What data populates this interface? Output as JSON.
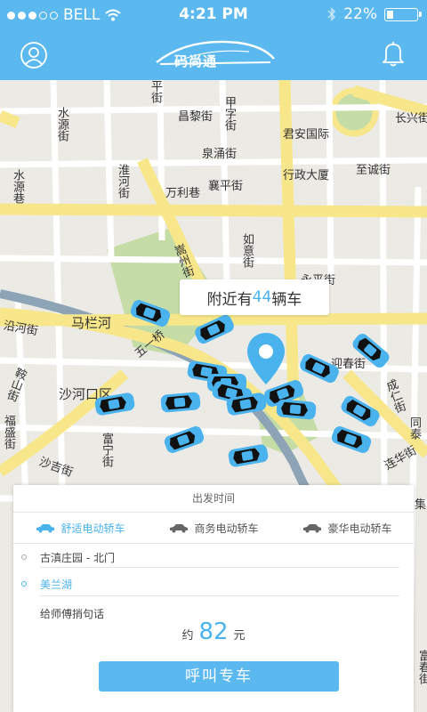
{
  "status_bar": {
    "carrier": "BELL",
    "time": "4:21 PM",
    "battery": "22%",
    "battery_level": 0.22
  },
  "header": {
    "logo_text": "码尚通",
    "user_icon": "user-icon",
    "bell_icon": "bell-icon"
  },
  "map": {
    "street_labels": [
      "平街",
      "昌黎街",
      "甲字街",
      "君安国际",
      "长兴街",
      "水源街",
      "泉涌街",
      "行政大厦",
      "至诚街",
      "淮河街",
      "水源巷",
      "万利巷",
      "襄平街",
      "如意街",
      "嵩州街",
      "永平街",
      "沿河街",
      "马栏河",
      "五一桥",
      "迎春街",
      "鞍山街",
      "沙河口区",
      "成仁街",
      "同泰",
      "福盛街",
      "富宁街",
      "沙吉街",
      "连华街",
      "富春街",
      "集"
    ],
    "bubble": {
      "prefix": "附近有",
      "count": "44",
      "suffix": "辆车"
    }
  },
  "card": {
    "section_title": "出发时间",
    "tabs": [
      {
        "label": "舒适电动轿车",
        "icon": "car-icon",
        "active": true
      },
      {
        "label": "商务电动轿车",
        "icon": "car-icon",
        "active": false
      },
      {
        "label": "豪华电动轿车",
        "icon": "car-icon",
        "active": false
      }
    ],
    "origin": "古滇庄园 - 北门",
    "destination": "美兰湖",
    "message_label": "给师傅捎句话",
    "price_prefix": "约",
    "price_value": "82",
    "price_unit": "元",
    "call_button": "呼叫专车"
  },
  "colors": {
    "accent": "#5bb9ef",
    "map_bg": "#eceae5",
    "road_yellow": "#f7e78a",
    "park_green": "#c5dca7",
    "river": "#8da3b6"
  }
}
